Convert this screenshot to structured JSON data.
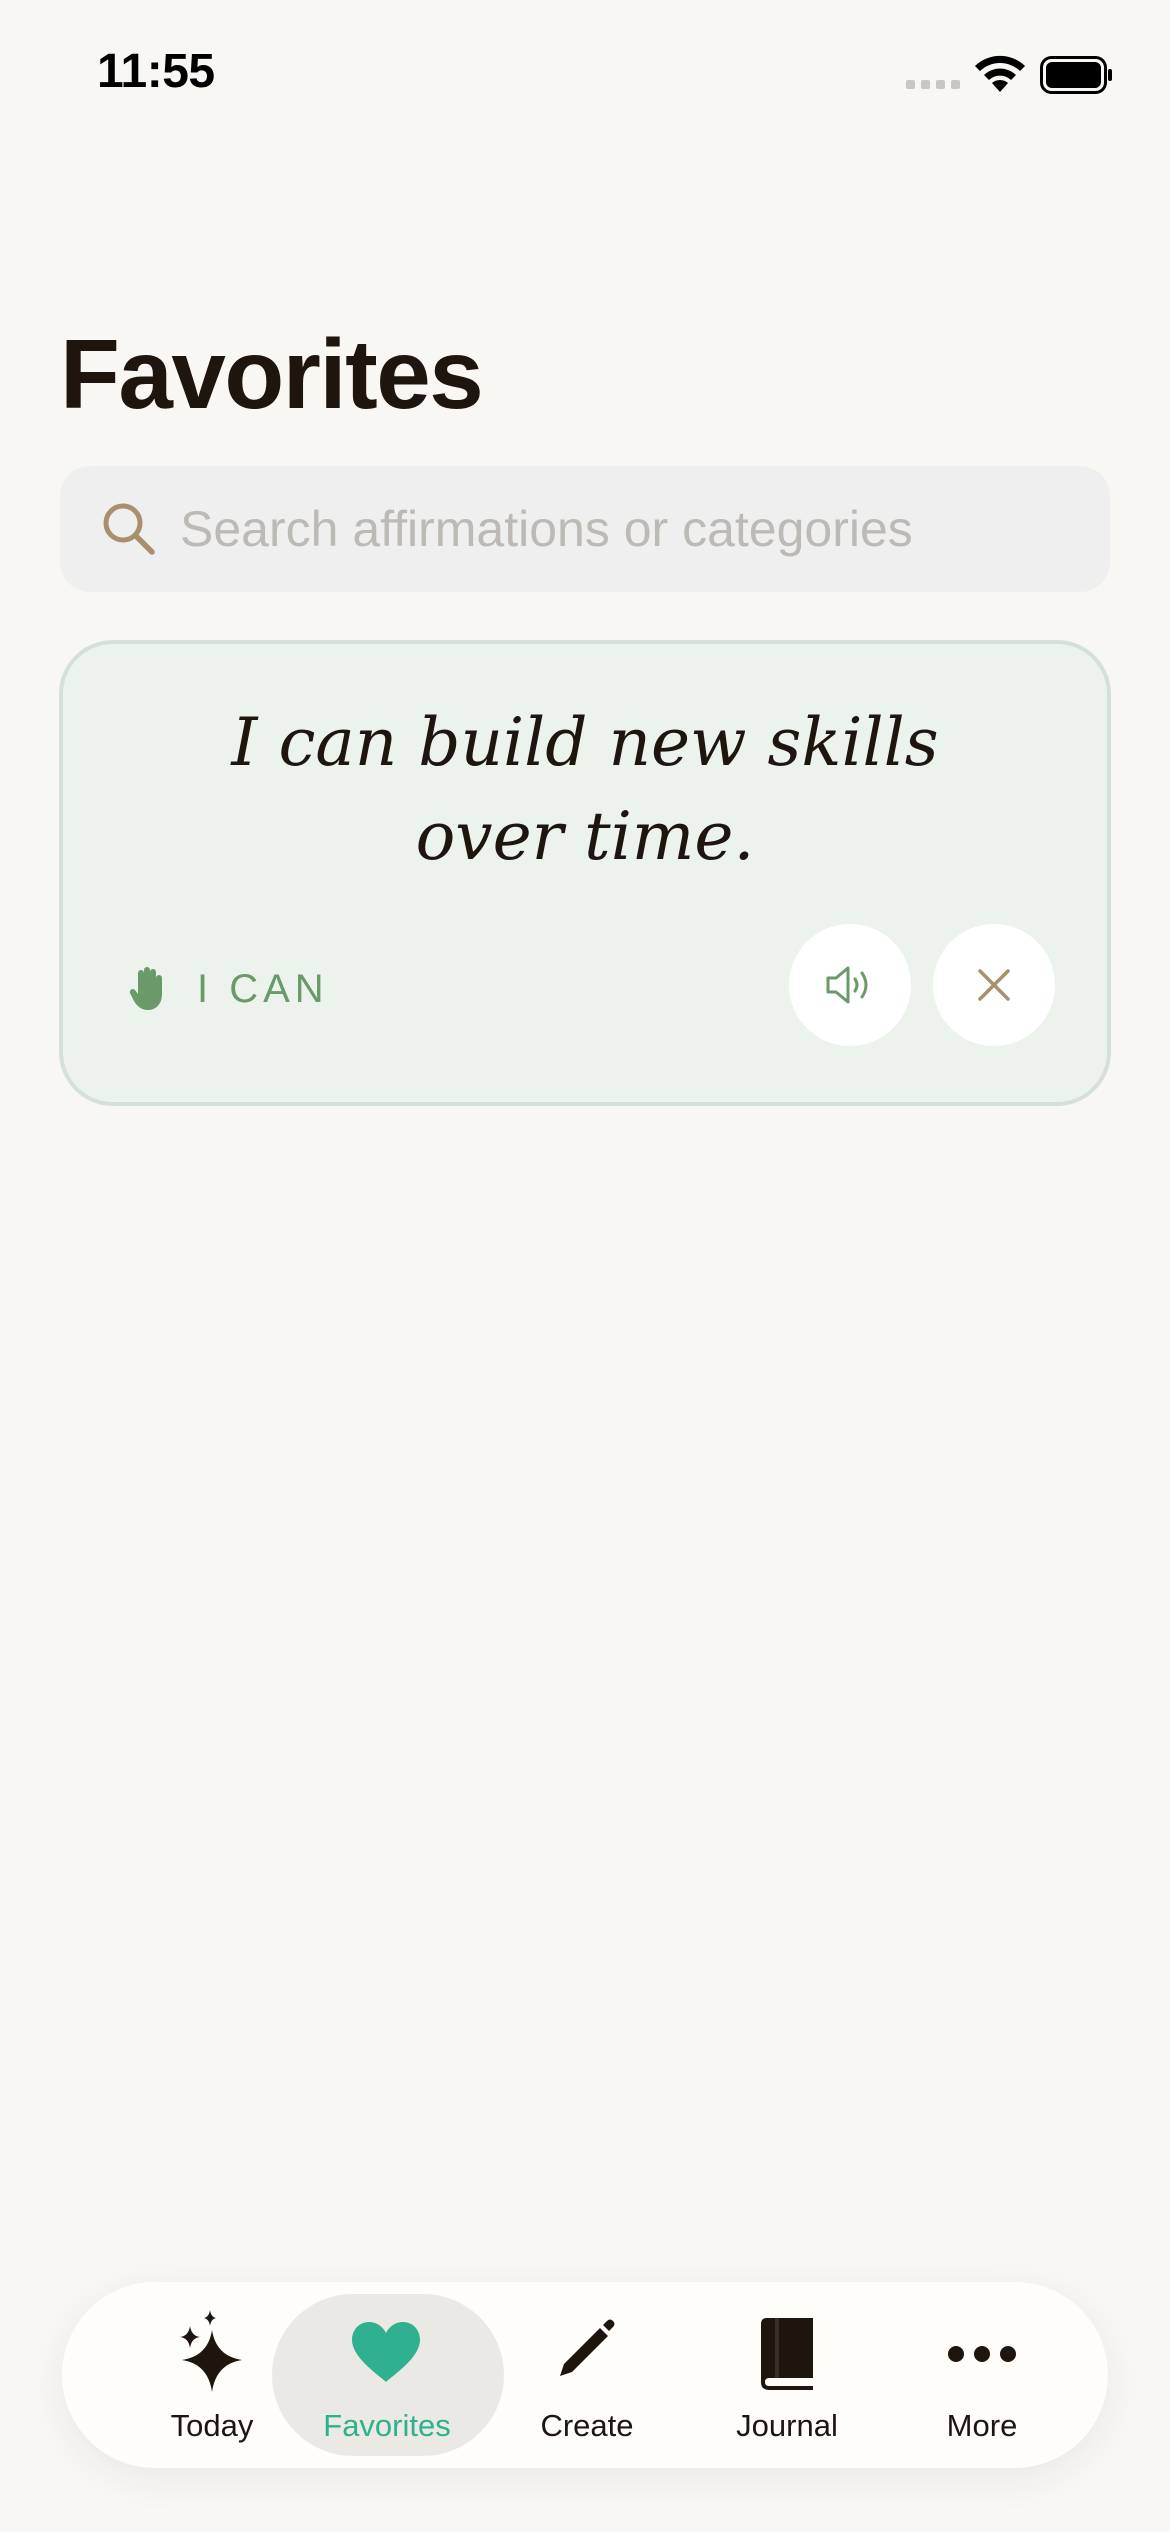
{
  "status_bar": {
    "time": "11:55"
  },
  "page": {
    "title": "Favorites"
  },
  "search": {
    "placeholder": "Search affirmations or categories",
    "value": ""
  },
  "favorites": [
    {
      "text_line1": "I can build new skills",
      "text_line2": "over time.",
      "category": "I CAN",
      "category_icon": "hand-icon"
    }
  ],
  "tab_bar": {
    "active": "Favorites",
    "tabs": [
      {
        "label": "Today",
        "icon": "sparkles-icon"
      },
      {
        "label": "Favorites",
        "icon": "heart-icon"
      },
      {
        "label": "Create",
        "icon": "pencil-icon"
      },
      {
        "label": "Journal",
        "icon": "book-icon"
      },
      {
        "label": "More",
        "icon": "ellipsis-icon"
      }
    ]
  },
  "colors": {
    "background": "#f9f7f3",
    "card_background": "#ecf3ec",
    "accent_green": "#6a9a6a",
    "accent_teal": "#2fb08f",
    "close_tan": "#a8906e"
  }
}
